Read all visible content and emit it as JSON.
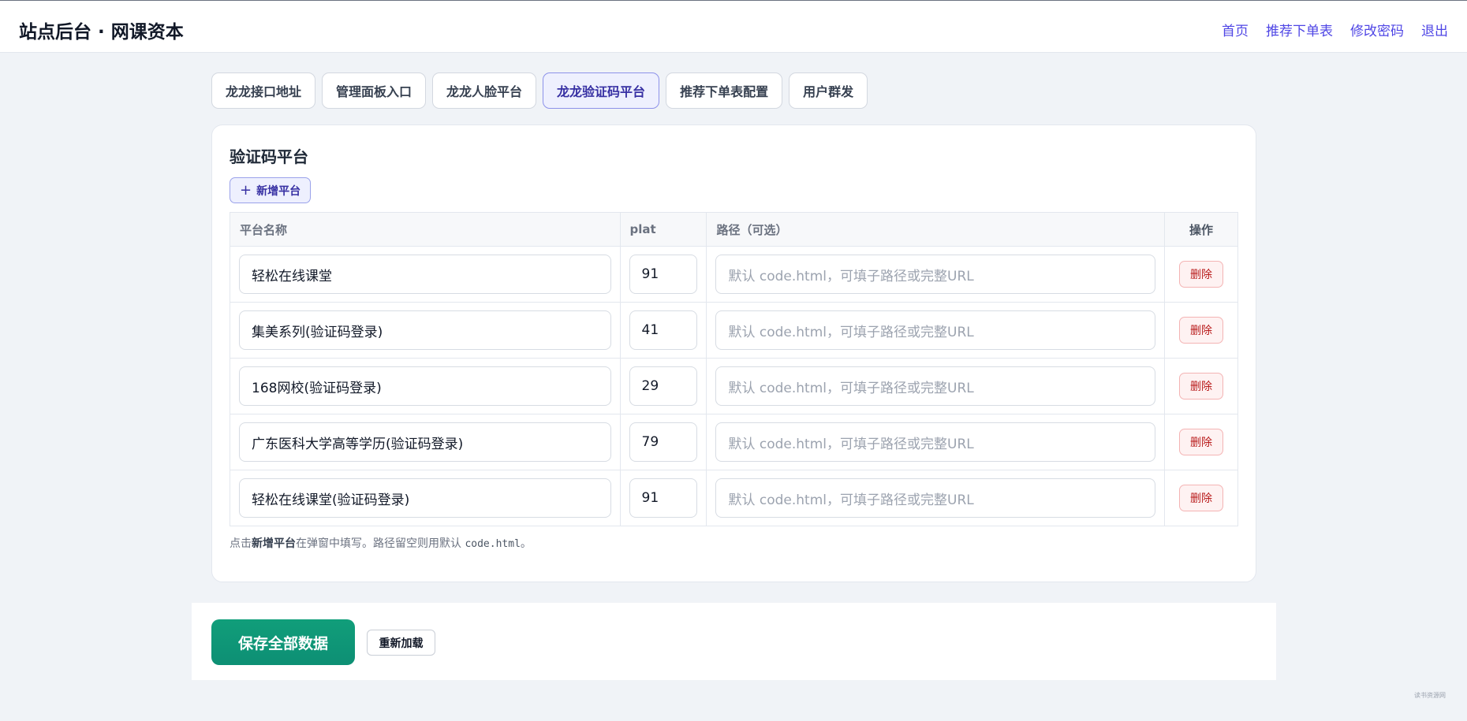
{
  "header": {
    "title": "站点后台 · 网课资本",
    "nav": [
      "首页",
      "推荐下单表",
      "修改密码",
      "退出"
    ]
  },
  "tabs": [
    {
      "label": "龙龙接口地址",
      "active": false
    },
    {
      "label": "管理面板入口",
      "active": false
    },
    {
      "label": "龙龙人脸平台",
      "active": false
    },
    {
      "label": "龙龙验证码平台",
      "active": true
    },
    {
      "label": "推荐下单表配置",
      "active": false
    },
    {
      "label": "用户群发",
      "active": false
    }
  ],
  "panel": {
    "title": "验证码平台",
    "add_button": "新增平台",
    "columns": {
      "name": "平台名称",
      "plat": "plat",
      "path": "路径（可选）",
      "op": "操作"
    },
    "path_placeholder": "默认 code.html，可填子路径或完整URL",
    "delete_label": "删除",
    "rows": [
      {
        "name": "轻松在线课堂",
        "plat": "91",
        "path": ""
      },
      {
        "name": "集美系列(验证码登录)",
        "plat": "41",
        "path": ""
      },
      {
        "name": "168网校(验证码登录)",
        "plat": "29",
        "path": ""
      },
      {
        "name": "广东医科大学高等学历(验证码登录)",
        "plat": "79",
        "path": ""
      },
      {
        "name": "轻松在线课堂(验证码登录)",
        "plat": "91",
        "path": ""
      }
    ],
    "note": {
      "prefix": "点击",
      "bold": "新增平台",
      "middle": "在弹窗中填写。路径留空则用默认 ",
      "code": "code.html",
      "suffix": "。"
    }
  },
  "footer": {
    "save_label": "保存全部数据",
    "reload_label": "重新加载"
  },
  "watermark": "读书资源网",
  "colors": {
    "accent": "#4f46e5",
    "save": "#0f9b78",
    "danger": "#b91c1c"
  }
}
